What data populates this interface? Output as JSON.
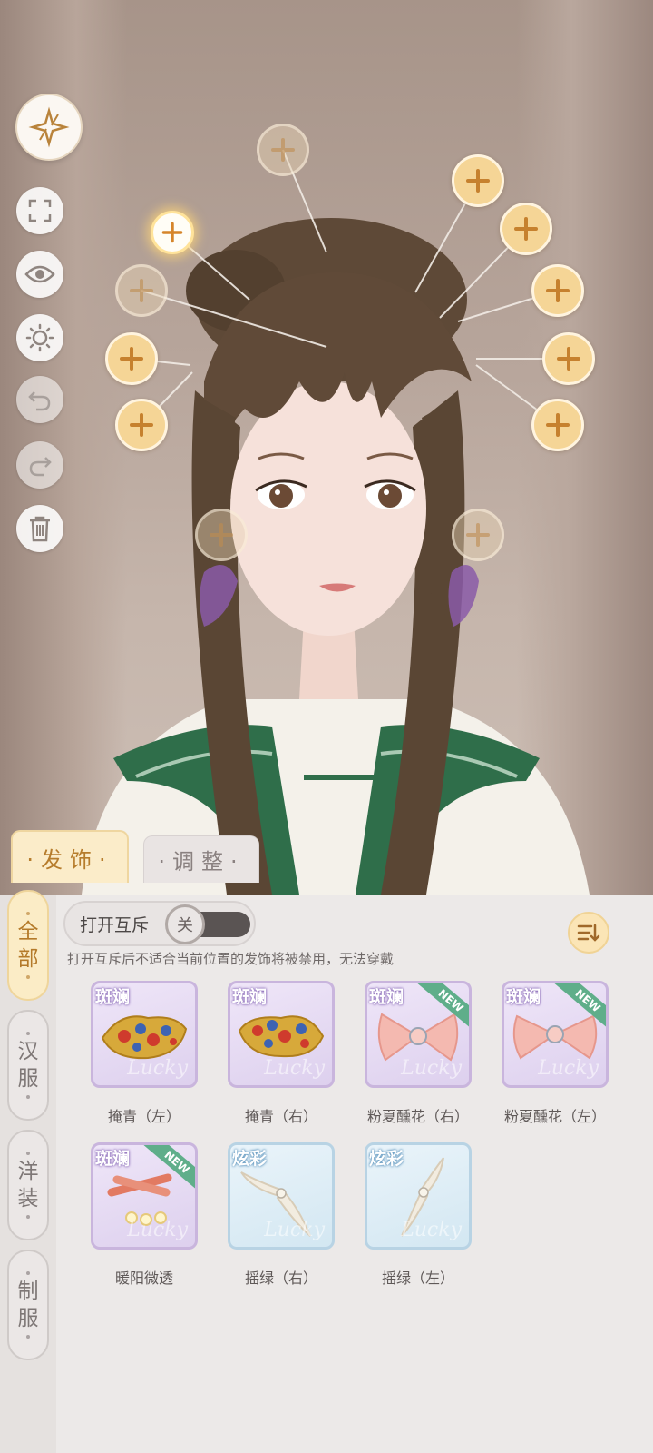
{
  "tabs": {
    "main": "·发饰·",
    "adjust": "·调整·"
  },
  "side_nav": [
    {
      "chars": [
        "全",
        "部"
      ],
      "active": true
    },
    {
      "chars": [
        "汉",
        "服"
      ],
      "active": false
    },
    {
      "chars": [
        "洋",
        "装"
      ],
      "active": false
    },
    {
      "chars": [
        "制",
        "服"
      ],
      "active": false
    }
  ],
  "toggle": {
    "label": "打开互斥",
    "state": "关"
  },
  "hint": "打开互斥后不适合当前位置的发饰将被禁用，无法穿戴",
  "items": [
    {
      "name": "掩青（左）",
      "rarity": "斑斓",
      "is_new": false,
      "style": "purple"
    },
    {
      "name": "掩青（右）",
      "rarity": "斑斓",
      "is_new": false,
      "style": "purple"
    },
    {
      "name": "粉夏醺花（右）",
      "rarity": "斑斓",
      "is_new": true,
      "style": "purple"
    },
    {
      "name": "粉夏醺花（左）",
      "rarity": "斑斓",
      "is_new": true,
      "style": "purple"
    },
    {
      "name": "暖阳微透",
      "rarity": "斑斓",
      "is_new": true,
      "style": "purple"
    },
    {
      "name": "摇绿（右）",
      "rarity": "炫彩",
      "is_new": false,
      "style": "blue"
    },
    {
      "name": "摇绿（左）",
      "rarity": "炫彩",
      "is_new": false,
      "style": "blue"
    }
  ],
  "badges": {
    "new": "NEW",
    "watermark": "Lucky"
  },
  "colors": {
    "accent": "#b67c2c",
    "hotspot": "#f5d596",
    "panel": "#ece9e8"
  },
  "icons": {
    "logo": "compass-star-icon",
    "tools": [
      "fullscreen-icon",
      "eye-icon",
      "lighting-icon",
      "undo-icon",
      "redo-icon",
      "trash-icon"
    ],
    "sort": "sort-icon",
    "hotspot": "plus-icon"
  }
}
